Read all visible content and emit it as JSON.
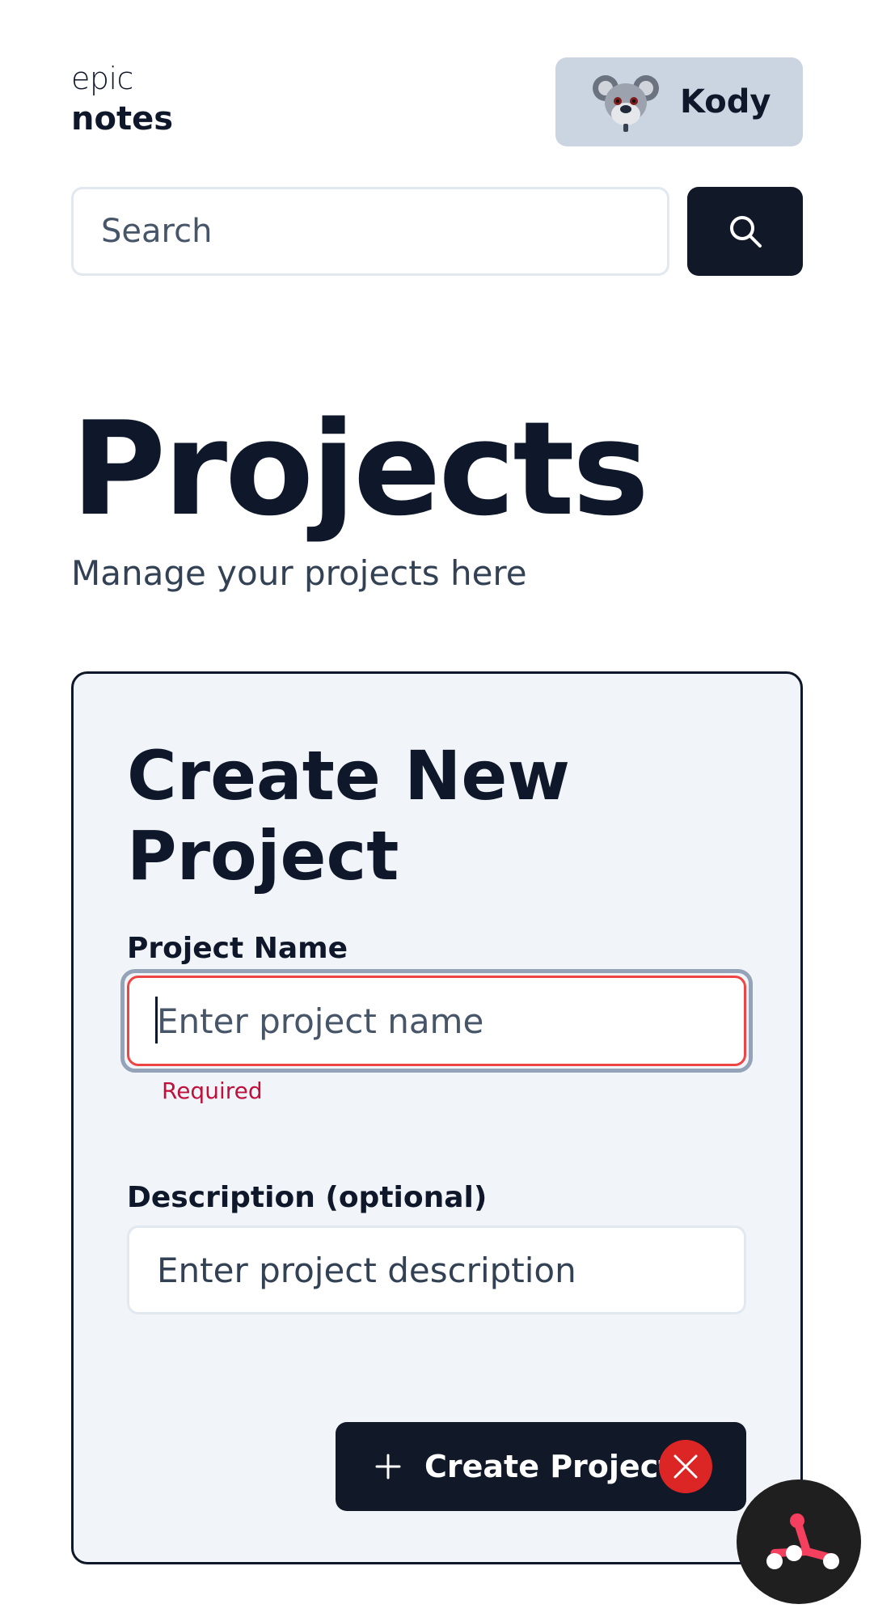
{
  "header": {
    "logo_top": "epic",
    "logo_bottom": "notes",
    "user_name": "Kody",
    "avatar_icon": "koala-avatar"
  },
  "search": {
    "placeholder": "Search",
    "button_icon": "search-icon"
  },
  "main": {
    "title": "Projects",
    "subtitle": "Manage your projects here"
  },
  "form": {
    "title": "Create New Project",
    "name_label": "Project Name",
    "name_placeholder": "Enter project name",
    "name_error": "Required",
    "description_label": "Description (optional)",
    "description_placeholder": "Enter project description",
    "submit_label": "Create Project",
    "submit_icon": "plus-icon",
    "error_badge_icon": "close-icon"
  },
  "floating": {
    "icon": "devtools-logo-icon"
  },
  "colors": {
    "primary_dark": "#111827",
    "user_button_bg": "#cbd5e1",
    "error": "#ef4444",
    "error_text": "#be123c",
    "card_bg": "#f1f5f9"
  }
}
